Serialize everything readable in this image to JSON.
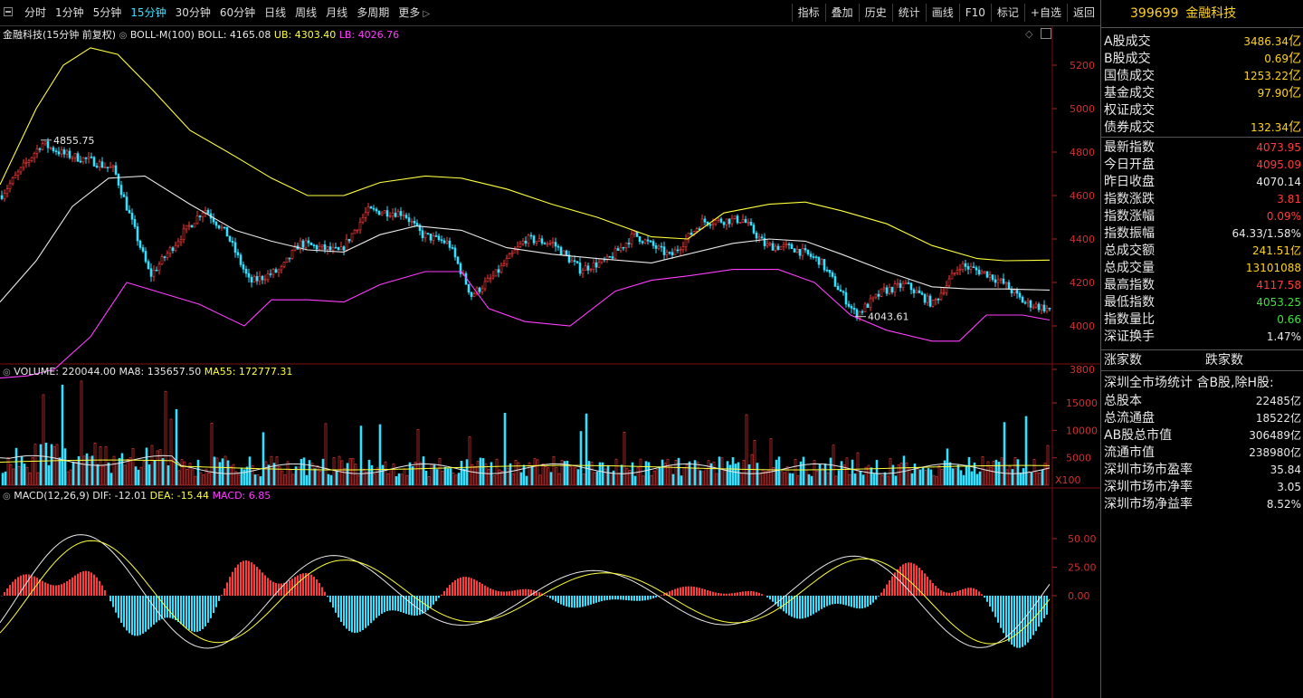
{
  "toolbar": {
    "periods": [
      "分时",
      "1分钟",
      "5分钟",
      "15分钟",
      "30分钟",
      "60分钟",
      "日线",
      "周线",
      "月线",
      "多周期",
      "更多"
    ],
    "active_period": "15分钟",
    "tools": [
      "指标",
      "叠加",
      "历史",
      "统计",
      "画线",
      "F10",
      "标记",
      "+自选",
      "返回"
    ]
  },
  "main_chart": {
    "title": "金融科技(15分钟 前复权)",
    "indicator_label": "BOLL-M(100)",
    "boll": "BOLL: 4165.08",
    "ub": "UB: 4303.40",
    "lb": "LB: 4026.76",
    "y_ticks": [
      "5200",
      "5000",
      "4800",
      "4600",
      "4400",
      "4200",
      "4000",
      "3800"
    ],
    "high_label": "4855.75",
    "low_label": "4043.61"
  },
  "volume_chart": {
    "label": "VOLUME: 220044.00",
    "ma8": "MA8: 135657.50",
    "ma55": "MA55: 172777.31",
    "y_ticks": [
      "15000",
      "10000",
      "5000"
    ],
    "unit": "X100"
  },
  "macd_chart": {
    "label": "MACD(12,26,9)",
    "dif": "DIF: -12.01",
    "dea": "DEA: -15.44",
    "macd": "MACD: 6.85",
    "y_ticks": [
      "50.00",
      "25.00",
      "0.00"
    ]
  },
  "panel": {
    "code": "399699",
    "name": "金融科技",
    "turnover": [
      {
        "label": "A股成交",
        "value": "3486.34",
        "unit": "亿"
      },
      {
        "label": "B股成交",
        "value": "0.69",
        "unit": "亿"
      },
      {
        "label": "国债成交",
        "value": "1253.22",
        "unit": "亿"
      },
      {
        "label": "基金成交",
        "value": "97.90",
        "unit": "亿"
      },
      {
        "label": "权证成交",
        "value": "",
        "unit": ""
      },
      {
        "label": "债券成交",
        "value": "132.34",
        "unit": "亿"
      }
    ],
    "index_stats": [
      {
        "label": "最新指数",
        "value": "4073.95",
        "color": "red"
      },
      {
        "label": "今日开盘",
        "value": "4095.09",
        "color": "red"
      },
      {
        "label": "昨日收盘",
        "value": "4070.14",
        "color": "white"
      },
      {
        "label": "指数涨跌",
        "value": "3.81",
        "color": "red"
      },
      {
        "label": "指数涨幅",
        "value": "0.09%",
        "color": "red"
      },
      {
        "label": "指数振幅",
        "value": "64.33/1.58%",
        "color": "white"
      },
      {
        "label": "总成交额",
        "value": "241.51亿",
        "color": "yellow"
      },
      {
        "label": "总成交量",
        "value": "13101088",
        "color": "yellow"
      },
      {
        "label": "最高指数",
        "value": "4117.58",
        "color": "red"
      },
      {
        "label": "最低指数",
        "value": "4053.25",
        "color": "green"
      },
      {
        "label": "指数量比",
        "value": "0.66",
        "color": "green"
      },
      {
        "label": "深证换手",
        "value": "1.47%",
        "color": "white"
      }
    ],
    "up_count_label": "涨家数",
    "down_count_label": "跌家数",
    "market_title": "深圳全市场统计 含B股,除H股:",
    "market_stats": [
      {
        "label": "总股本",
        "value": "22485亿"
      },
      {
        "label": "总流通盘",
        "value": "18522亿"
      },
      {
        "label": "AB股总市值",
        "value": "306489亿"
      },
      {
        "label": "流通市值",
        "value": "238980亿"
      },
      {
        "label": "深圳市场市盈率",
        "value": "35.84"
      },
      {
        "label": "深圳市场市净率",
        "value": "3.05"
      },
      {
        "label": "深圳市场净益率",
        "value": "8.52%"
      }
    ]
  }
}
